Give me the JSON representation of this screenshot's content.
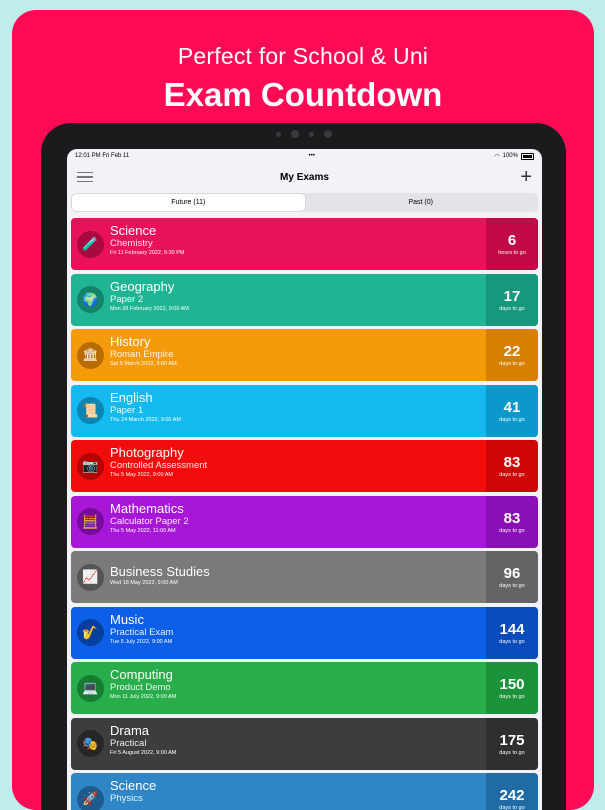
{
  "promo": {
    "subtitle": "Perfect for School & Uni",
    "title": "Exam Countdown"
  },
  "status": {
    "time_date": "12:01 PM  Fri Feb 11",
    "dots": "•••",
    "battery": "100%"
  },
  "nav": {
    "title": "My Exams",
    "add_label": "+"
  },
  "tabs": {
    "future": "Future (11)",
    "past": "Past (0)"
  },
  "exams": [
    {
      "subject": "Science",
      "detail": "Chemistry",
      "date": "Fri 11 February 2022, 6:30 PM",
      "count": "6",
      "unit": "hours to go",
      "color": "#e8115a",
      "count_color": "#c10a45",
      "icon_color": "#a8093e",
      "icon": "🧪",
      "icon_name": "test-tubes-icon"
    },
    {
      "subject": "Geography",
      "detail": "Paper 2",
      "date": "Mon 28 February 2022, 9:00 AM",
      "count": "17",
      "unit": "days to go",
      "color": "#1fb594",
      "count_color": "#17977b",
      "icon_color": "#14836a",
      "icon": "🌍",
      "icon_name": "globe-icon"
    },
    {
      "subject": "History",
      "detail": "Roman Empire",
      "date": "Sat 5 March 2022, 9:00 AM",
      "count": "22",
      "unit": "days to go",
      "color": "#f59a0a",
      "count_color": "#d77f00",
      "icon_color": "#b86c00",
      "icon": "🏛",
      "icon_name": "helmet-icon"
    },
    {
      "subject": "English",
      "detail": "Paper 1",
      "date": "Thu 24 March 2022, 9:00 AM",
      "count": "41",
      "unit": "days to go",
      "color": "#13b9ef",
      "count_color": "#0b99cb",
      "icon_color": "#0b86b2",
      "icon": "📜",
      "icon_name": "book-icon"
    },
    {
      "subject": "Photography",
      "detail": "Controlled Assessment",
      "date": "Thu 5 May 2022, 9:00 AM",
      "count": "83",
      "unit": "days to go",
      "color": "#f20c0c",
      "count_color": "#cf0606",
      "icon_color": "#b30404",
      "icon": "📷",
      "icon_name": "camera-icon"
    },
    {
      "subject": "Mathematics",
      "detail": "Calculator Paper 2",
      "date": "Thu 5 May 2022, 11:00 AM",
      "count": "83",
      "unit": "days to go",
      "color": "#a817d8",
      "count_color": "#8b0fb6",
      "icon_color": "#770c9c",
      "icon": "🧮",
      "icon_name": "calculator-icon"
    },
    {
      "subject": "Business Studies",
      "detail": "",
      "date": "Wed 18 May 2022, 9:00 AM",
      "count": "96",
      "unit": "days to go",
      "color": "#7a7a7a",
      "count_color": "#646464",
      "icon_color": "#555",
      "icon": "📈",
      "icon_name": "chart-board-icon"
    },
    {
      "subject": "Music",
      "detail": "Practical Exam",
      "date": "Tue 5 July 2022, 9:00 AM",
      "count": "144",
      "unit": "days to go",
      "color": "#0c5fe6",
      "count_color": "#084bbb",
      "icon_color": "#063f9e",
      "icon": "🎷",
      "icon_name": "saxophone-icon"
    },
    {
      "subject": "Computing",
      "detail": "Product Demo",
      "date": "Mon 11 July 2022, 9:00 AM",
      "count": "150",
      "unit": "days to go",
      "color": "#27ae4a",
      "count_color": "#1c923b",
      "icon_color": "#177c31",
      "icon": "💻",
      "icon_name": "computer-icon"
    },
    {
      "subject": "Drama",
      "detail": "Practical",
      "date": "Fri 5 August 2022, 9:00 AM",
      "count": "175",
      "unit": "days to go",
      "color": "#3d3d3d",
      "count_color": "#2f2f2f",
      "icon_color": "#262626",
      "icon": "🎭",
      "icon_name": "masks-icon"
    },
    {
      "subject": "Science",
      "detail": "Physics",
      "date": "",
      "count": "242",
      "unit": "days to go",
      "color": "#2f86c7",
      "count_color": "#216ba4",
      "icon_color": "#1c5b8c",
      "icon": "🚀",
      "icon_name": "rocket-icon"
    }
  ]
}
